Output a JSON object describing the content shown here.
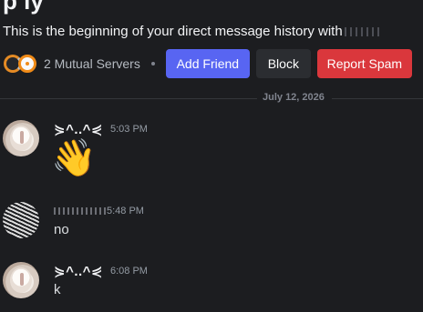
{
  "header": {
    "partial_title": "p  ly",
    "history_text": "This is the beginning of your direct message history with",
    "history_name_obscured": ""
  },
  "profile_actions": {
    "server_icons": [
      "overwatch-icon",
      "overwatch-icon"
    ],
    "mutual_servers": "2 Mutual Servers",
    "add_friend": "Add Friend",
    "block": "Block",
    "report_spam": "Report Spam"
  },
  "colors": {
    "add_friend_bg": "#5865f2",
    "block_bg": "#2b2d31",
    "report_bg": "#da373c",
    "background": "#1c1d20"
  },
  "date_divider": "July 12, 2026",
  "messages": [
    {
      "username": "⋟^..^⋞",
      "timestamp": "5:03 PM",
      "content": "👋",
      "avatar": "cat-avatar"
    },
    {
      "username": "",
      "timestamp": "5:48 PM",
      "content": "no",
      "avatar": "noise-avatar"
    },
    {
      "username": "⋟^..^⋞",
      "timestamp": "6:08 PM",
      "content": "k",
      "avatar": "cat-avatar"
    }
  ]
}
